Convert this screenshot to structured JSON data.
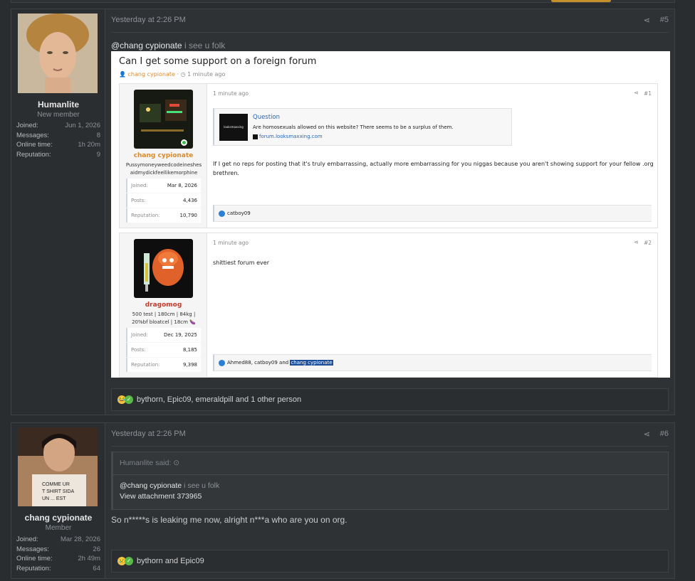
{
  "posts": [
    {
      "user": {
        "name": "Humanlite",
        "title": "New member",
        "stats": [
          {
            "label": "Joined:",
            "value": "Jun 1, 2026"
          },
          {
            "label": "Messages:",
            "value": "8"
          },
          {
            "label": "Online time:",
            "value": "1h 20m"
          },
          {
            "label": "Reputation:",
            "value": "9"
          }
        ]
      },
      "date": "Yesterday at 2:26 PM",
      "number": "#5",
      "mention": "@chang cypionate",
      "text": "i see u folk",
      "reactions": "bythorn, Epic09, emeraldpill and 1 other person"
    },
    {
      "user": {
        "name": "chang cypionate",
        "title": "Member",
        "stats": [
          {
            "label": "Joined:",
            "value": "Mar 28, 2026"
          },
          {
            "label": "Messages:",
            "value": "26"
          },
          {
            "label": "Online time:",
            "value": "2h 49m"
          },
          {
            "label": "Reputation:",
            "value": "64"
          }
        ]
      },
      "date": "Yesterday at 2:26 PM",
      "number": "#6",
      "quote": {
        "author": "Humanlite said:",
        "mention": "@chang cypionate",
        "text": "i see u folk",
        "attachment": "View attachment 373965"
      },
      "message": "So n*****s is leaking me now, alright n***a who are you on org.",
      "reactions": "bythorn and Epic09"
    }
  ],
  "screenshot": {
    "thread_title": "Can I get some support on a foreign forum",
    "author": "chang cypionate",
    "time": "1 minute ago",
    "posts": [
      {
        "user": "chang cypionate",
        "signature": "Pussymoneyweedcodeineshes aidmydickfeellikemorphine",
        "stats": [
          {
            "label": "Joined:",
            "value": "Mar 8, 2026"
          },
          {
            "label": "Posts:",
            "value": "4,436"
          },
          {
            "label": "Reputation:",
            "value": "10,790"
          }
        ],
        "time": "1 minute ago",
        "number": "#1",
        "embed": {
          "logo": "looksmaxxing",
          "title": "Question",
          "desc": "Are homosexuals allowed on this website? There seems to be a surplus of them.",
          "url": "forum.looksmaxxing.com"
        },
        "body": "If I get no reps for posting that it's truly embarrassing, actually more embarrassing for you niggas because you aren't showing support for your fellow .org brethren.",
        "reactions": "catboy09"
      },
      {
        "user": "dragomog",
        "signature": "500 test | 180cm | 84kg | 20%bf bloatcel | 18cm 🍆",
        "stats": [
          {
            "label": "Joined:",
            "value": "Dec 19, 2025"
          },
          {
            "label": "Posts:",
            "value": "8,185"
          },
          {
            "label": "Reputation:",
            "value": "9,398"
          }
        ],
        "time": "1 minute ago",
        "number": "#2",
        "body": "shittiest forum ever",
        "reactions_prefix": "Ahmed88, catboy09 and",
        "reactions_highlight": "chang cypionate"
      }
    ]
  },
  "colors": {
    "accent": "#d88a2c",
    "link": "#2a66b5",
    "background": "#2a2d30"
  }
}
